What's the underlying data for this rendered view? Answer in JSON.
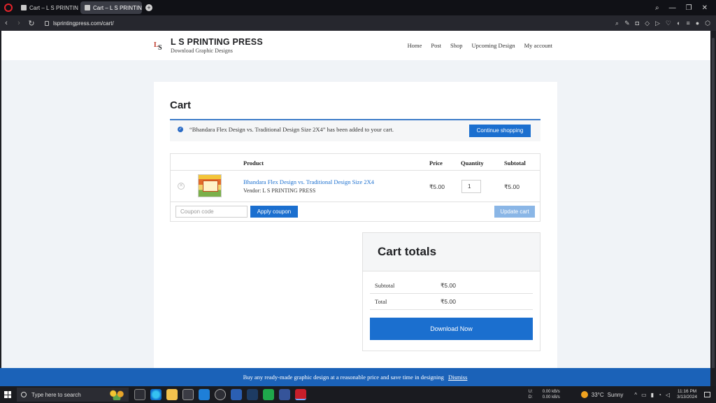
{
  "browser": {
    "tabs": [
      {
        "title": "Cart – L S PRINTING PRESS"
      },
      {
        "title": "Cart – L S PRINTING PRESS"
      }
    ],
    "new_tab": "+",
    "url": "lsprintingpress.com/cart/"
  },
  "site": {
    "title": "L S PRINTING PRESS",
    "tagline": "Download Graphic Designs",
    "nav": [
      "Home",
      "Post",
      "Shop",
      "Upcoming Design",
      "My account"
    ]
  },
  "cart": {
    "title": "Cart",
    "notice": "“Bhandara Flex Design vs. Traditional Design Size 2X4” has been added to your cart.",
    "continue_label": "Continue shopping",
    "headers": {
      "product": "Product",
      "price": "Price",
      "quantity": "Quantity",
      "subtotal": "Subtotal"
    },
    "item": {
      "name": "Bhandara Flex Design vs. Traditional Design Size 2X4",
      "vendor": "Vendor: L S PRINTING PRESS",
      "price": "₹5.00",
      "quantity": "1",
      "subtotal": "₹5.00"
    },
    "coupon_placeholder": "Coupon code",
    "apply_label": "Apply coupon",
    "update_label": "Update cart"
  },
  "totals": {
    "title": "Cart totals",
    "subtotal_label": "Subtotal",
    "subtotal_value": "₹5.00",
    "total_label": "Total",
    "total_value": "₹5.00",
    "download_label": "Download Now"
  },
  "store_notice": {
    "text": "Buy any ready-made graphic design at a reasonable price and save time in designing",
    "dismiss": "Dismiss"
  },
  "taskbar": {
    "search_placeholder": "Type here to search",
    "net_u_label": "U:",
    "net_u_value": "0.00 kB/s",
    "net_d_label": "D:",
    "net_d_value": "0.00 kB/s",
    "temperature": "33°C",
    "weather": "Sunny",
    "time": "11:16 PM",
    "date": "3/13/2024"
  },
  "colors": {
    "accent": "#1b6fcf",
    "notice_bar": "#1b62b8",
    "update_disabled": "#8ab6e6"
  }
}
